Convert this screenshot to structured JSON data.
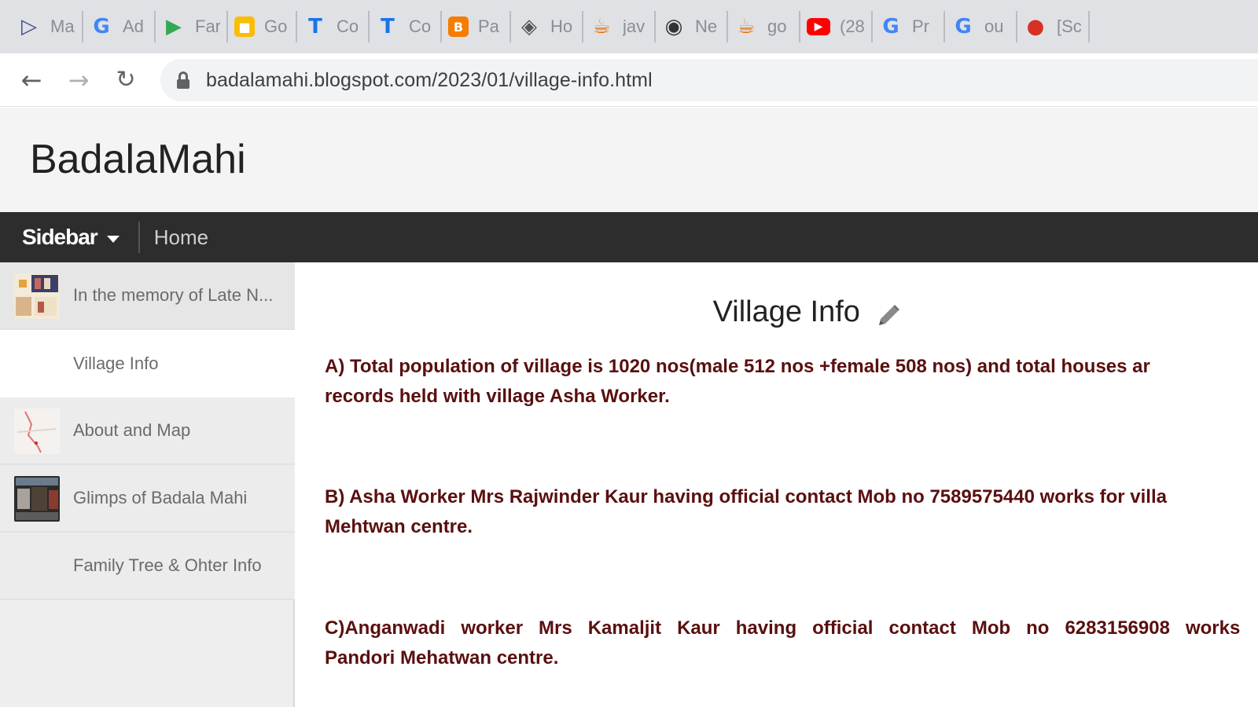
{
  "bookmarks": [
    {
      "label": "Ma",
      "icon": "flag-icon",
      "color": "#3c4a8c"
    },
    {
      "label": "Ad",
      "icon": "google-icon",
      "color": "#4285f4"
    },
    {
      "label": "Far",
      "icon": "play-store-icon",
      "color": "#34a853"
    },
    {
      "label": "Go",
      "icon": "keep-icon",
      "color": "#fbbc04"
    },
    {
      "label": "Co",
      "icon": "t-icon",
      "color": "#1a73e8"
    },
    {
      "label": "Co",
      "icon": "t-icon",
      "color": "#1a73e8"
    },
    {
      "label": "Pa",
      "icon": "blogger-icon",
      "color": "#f57d00"
    },
    {
      "label": "Ho",
      "icon": "diamond-icon",
      "color": "#555555"
    },
    {
      "label": "jav",
      "icon": "java-icon",
      "color": "#e76f00"
    },
    {
      "label": "Ne",
      "icon": "chrome-icon",
      "color": "#333333"
    },
    {
      "label": "go",
      "icon": "java-icon",
      "color": "#e76f00"
    },
    {
      "label": "(28",
      "icon": "youtube-icon",
      "color": "#ff0000"
    },
    {
      "label": "Pr",
      "icon": "google-icon",
      "color": "#4285f4"
    },
    {
      "label": "ou",
      "icon": "google-icon",
      "color": "#4285f4"
    },
    {
      "label": "[Sc",
      "icon": "apple-icon",
      "color": "#d93025"
    }
  ],
  "browser": {
    "url": "badalamahi.blogspot.com/2023/01/village-info.html"
  },
  "blog": {
    "title": "BadalaMahi"
  },
  "menu": {
    "sidebar_label": "Sidebar",
    "home_label": "Home"
  },
  "sidebar": {
    "items": [
      {
        "label": "In the memory of Late N..."
      },
      {
        "label": "Village Info"
      },
      {
        "label": "About and Map"
      },
      {
        "label": "Glimps of Badala Mahi"
      },
      {
        "label": "Family Tree & Ohter Info"
      }
    ]
  },
  "post": {
    "title": "Village Info",
    "para_a_line1": " A) Total population of village is 1020 nos(male 512 nos +female 508 nos) and total houses ar",
    "para_a_line2": "records held with village Asha Worker.",
    "para_b_line1": "B) Asha Worker Mrs Rajwinder Kaur having official contact Mob no 7589575440 works for villa",
    "para_b_line2": "Mehtwan centre.",
    "para_c_line1": "C)Anganwadi   worker   Mrs   Kamaljit   Kaur   having   official   contact   Mob   no   6283156908   works",
    "para_c_line2": "Pandori Mehatwan centre."
  }
}
